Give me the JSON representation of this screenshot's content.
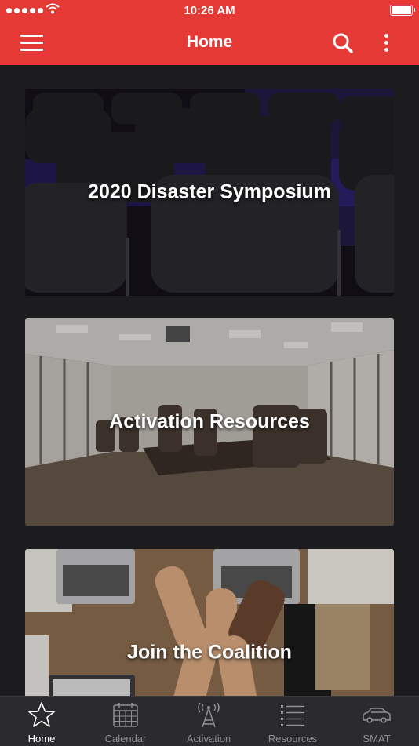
{
  "status_bar": {
    "time": "10:26 AM"
  },
  "header": {
    "title": "Home"
  },
  "cards": [
    {
      "label": "2020 Disaster Symposium"
    },
    {
      "label": "Activation Resources"
    },
    {
      "label": "Join the Coalition"
    }
  ],
  "tabs": [
    {
      "label": "Home",
      "icon": "star-icon",
      "active": true
    },
    {
      "label": "Calendar",
      "icon": "calendar-icon"
    },
    {
      "label": "Activation",
      "icon": "radio-tower-icon"
    },
    {
      "label": "Resources",
      "icon": "list-icon"
    },
    {
      "label": "SMAT",
      "icon": "car-icon"
    }
  ],
  "colors": {
    "accent": "#e53935",
    "background": "#1c1c1e",
    "tabbar": "#2b2b2e"
  }
}
